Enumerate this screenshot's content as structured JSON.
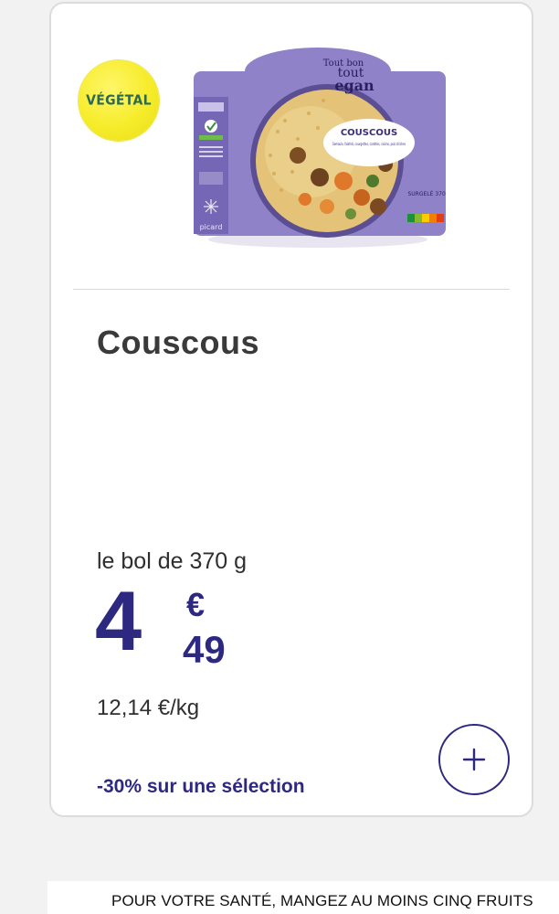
{
  "badge": {
    "label": "VÉGÉTAL"
  },
  "product_image": {
    "brand_top": "Tout bon",
    "brand_mid": "tout",
    "brand_bottom": "egan",
    "label_title": "COUSCOUS",
    "label_sub": "Semoule, falafels, courgettes, carottes, raisins, pois chiches",
    "weight": "SURGELÉ 370 g",
    "retailer": "picard",
    "side_label_1": "VEGAN",
    "nutriscore": "A B C D E"
  },
  "product": {
    "title": "Couscous",
    "unit": "le bol de 370 g",
    "price_int": "4",
    "price_currency": "€",
    "price_dec": "49",
    "per_kg": "12,14 €/kg",
    "promo": "-30% sur une sélection"
  },
  "footer": {
    "text": "POUR VOTRE SANTÉ, MANGEZ AU MOINS CINQ FRUITS"
  },
  "colors": {
    "price": "#2d2880",
    "badge": "#f6ec2a",
    "badge_text": "#2d6a4f",
    "packaging": "#8f82c9"
  }
}
